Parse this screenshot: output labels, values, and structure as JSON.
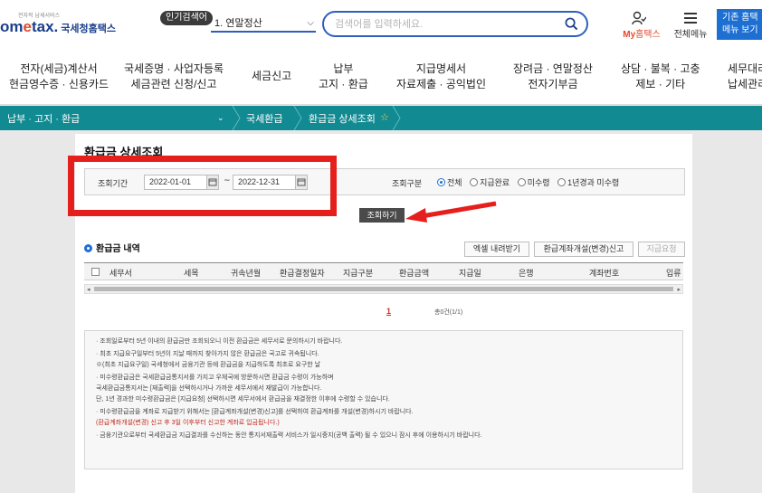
{
  "header": {
    "logo_prefix": "om",
    "logo_e": "e",
    "logo_suffix": "tax.",
    "logo_sub": "국세청홈택스",
    "logo_small": "전자적 납세서비스",
    "popular_badge": "인기검색어",
    "popular_selected": "1. 연말정산",
    "search_placeholder": "검색어를 입력하세요.",
    "my_hometax_prefix": "My",
    "my_hometax_suffix": "홈택스",
    "all_menu": "전체메뉴",
    "corner_line1": "기존 홈택",
    "corner_line2": "메뉴 보기"
  },
  "gnb": [
    {
      "line1": "전자(세금)계산서",
      "line2": "현금영수증 · 신용카드"
    },
    {
      "line1": "국세증명 · 사업자등록",
      "line2": "세금관련 신청/신고"
    },
    {
      "line1": "세금신고",
      "line2": ""
    },
    {
      "line1": "납부",
      "line2": "고지 · 환급"
    },
    {
      "line1": "지급명세서",
      "line2": "자료제출 · 공익법인"
    },
    {
      "line1": "장려금 · 연말정산",
      "line2": "전자기부금"
    },
    {
      "line1": "상담 · 불복 · 고충",
      "line2": "제보 · 기타"
    },
    {
      "line1": "세무대리",
      "line2": "납세관리"
    }
  ],
  "breadcrumb": {
    "level1": "납부 · 고지 · 환급",
    "level2": "국세환급",
    "level3": "환급금 상세조회"
  },
  "page": {
    "title": "환급금 상세조회",
    "period_label": "조회기간",
    "date_from": "2022-01-01",
    "tilde": "~",
    "date_to": "2022-12-31",
    "type_label": "조회구분",
    "radios": [
      {
        "label": "전체",
        "selected": true
      },
      {
        "label": "지급완료",
        "selected": false
      },
      {
        "label": "미수령",
        "selected": false
      },
      {
        "label": "1년경과 미수령",
        "selected": false
      }
    ],
    "search_button": "조회하기",
    "section_title": "환급금 내역",
    "buttons": {
      "excel": "엑셀 내려받기",
      "account": "환급계좌개설(변경)신고",
      "request": "지급요청"
    },
    "columns": [
      "세무서",
      "세목",
      "귀속년월",
      "환급결정일자",
      "지급구분",
      "환급금액",
      "지급일",
      "은행",
      "계좌번호",
      "입류"
    ],
    "pager_current": "1",
    "total": "총0건(1/1)"
  },
  "notices": [
    {
      "text": "· 조회일로부터 5년 이내의 환급금만 조회되오니 이전 환급금은 세무서로 문의하시기 바랍니다.",
      "style": "normal"
    },
    {
      "text": "· 최초 지급요구일부터 5년이 지날 때까지 찾아가지 않은 환급금은 국고로 귀속됩니다.",
      "style": "gap"
    },
    {
      "text": "   ※(최초 지급요구일) 국세청에서 금융기관 등에 환급금을 지급하도록 최초로 요구한 날",
      "style": "normal"
    },
    {
      "text": "· 미수령환급금은 국세환급금통지서를 가지고 우체국에 방문하시면 환급금 수령이 가능하며",
      "style": "gap"
    },
    {
      "text": "  국세환급금통지서는 [재출력]을 선택하시거나 가까운 세무서에서 재발급이 가능합니다.",
      "style": "normal"
    },
    {
      "text": "  단, 1년 경과한 미수령환급금은 [지급요청] 선택하시면 세무서에서 환급금을 재결정한 이후에 수령할 수 있습니다.",
      "style": "normal"
    },
    {
      "text": "· 미수령환급금을 계좌로 지급받기 위해서는 [환급계좌개설(변경)신고]를 선택하여 환급계좌를 개설(변경)하시기 바랍니다.",
      "style": "gap"
    },
    {
      "text": "  (환급계좌개설(변경) 신고 후 3일 이후부터 신고한 계좌로 입금됩니다.)",
      "style": "red"
    },
    {
      "text": "· 금융기관으로부터 국세환급금 지급결과를 수신하는 동안 통지서재출력 서비스가 일시중지(공백 출력) 될 수 있으니 잠시 후에 이용하시기 바랍니다.",
      "style": "gap"
    }
  ],
  "colors": {
    "brand_blue": "#1a3e8c",
    "accent_blue": "#1d6fd1",
    "teal_bar": "#128a92",
    "highlight_red": "#e5201c"
  }
}
